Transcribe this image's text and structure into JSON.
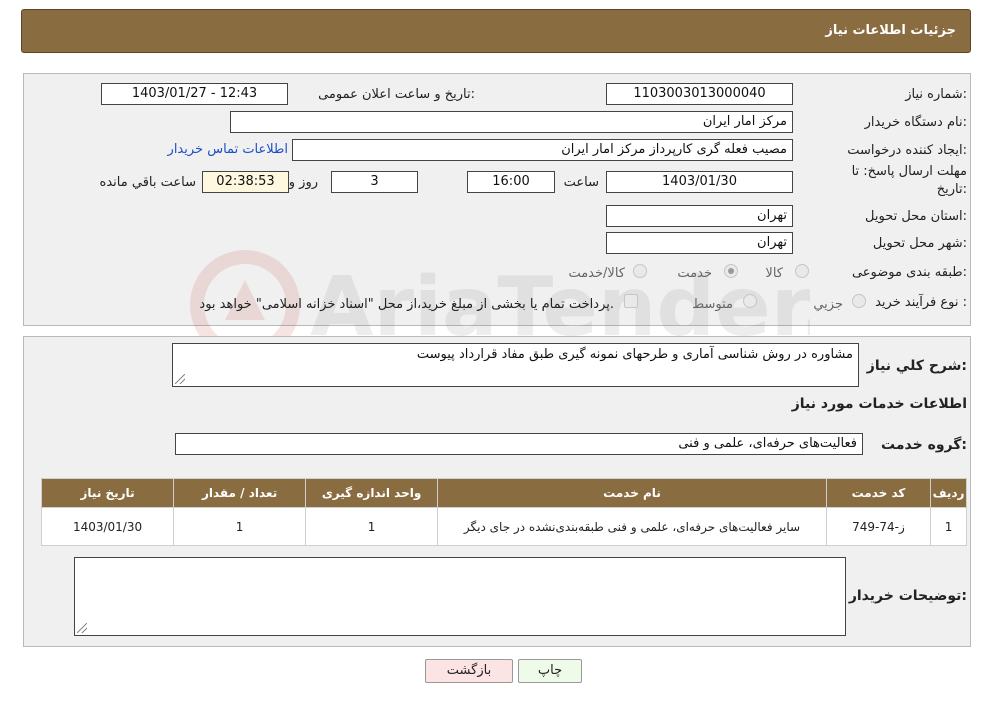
{
  "header": {
    "title": "جزئیات اطلاعات نیاز"
  },
  "form": {
    "need_number_label": "شماره نیاز:",
    "need_number": "1103003013000040",
    "announce_label": "تاریخ و ساعت اعلان عمومی:",
    "announce_value": "1403/01/27 - 12:43",
    "buyer_org_label": "نام دستگاه خریدار:",
    "buyer_org": "مرکز امار ایران",
    "requester_label": "ایجاد کننده درخواست:",
    "requester": "مصیب فعله گری کارپرداز مرکز امار ایران",
    "contact_link": "اطلاعات تماس خریدار",
    "deadline_label_1": "مهلت ارسال پاسخ: تا",
    "deadline_label_2": "تاریخ:",
    "deadline_date": "1403/01/30",
    "time_label": "ساعت",
    "deadline_time": "16:00",
    "days_value": "3",
    "days_label": "روز و",
    "remaining_time": "02:38:53",
    "remaining_label": "ساعت باقي مانده",
    "province_label": "استان محل تحویل:",
    "province": "تهران",
    "city_label": "شهر محل تحویل:",
    "city": "تهران",
    "category_label": "طبقه بندی موضوعی:",
    "category_options": [
      "کالا",
      "خدمت",
      "کالا/خدمت"
    ],
    "process_label": "نوع فرآیند خرید :",
    "process_options": [
      "جزیي",
      "متوسط"
    ],
    "payment_note": "پرداخت تمام یا بخشی از مبلغ خرید،از محل \"اسناد خزانه اسلامی\" خواهد بود."
  },
  "details": {
    "summary_label": "شرح کلي نياز:",
    "summary": "مشاوره در روش شناسی آماری و طرحهای نمونه گیری طبق مفاد قرارداد پیوست",
    "services_title": "اطلاعات خدمات مورد نیاز",
    "service_group_label": "گروه خدمت:",
    "service_group": "فعالیت‌های حرفه‌ای، علمی و فنی",
    "table": {
      "headers": [
        "ردیف",
        "کد خدمت",
        "نام خدمت",
        "واحد اندازه گیری",
        "تعداد / مقدار",
        "تاریخ نیاز"
      ],
      "rows": [
        [
          "1",
          "ز-74-749",
          "سایر فعالیت‌های حرفه‌ای، علمی و فنی طبقه‌بندی‌نشده در جای دیگر",
          "1",
          "1",
          "1403/01/30"
        ]
      ]
    },
    "buyer_notes_label": "توضیحات خریدار:",
    "buyer_notes": ""
  },
  "buttons": {
    "print": "چاپ",
    "back": "بازگشت"
  },
  "colors": {
    "header_bg": "#8a6c41",
    "panel_bg": "#f0f0f0",
    "print_bg": "#eefbe8",
    "back_bg": "#fde4e4"
  }
}
